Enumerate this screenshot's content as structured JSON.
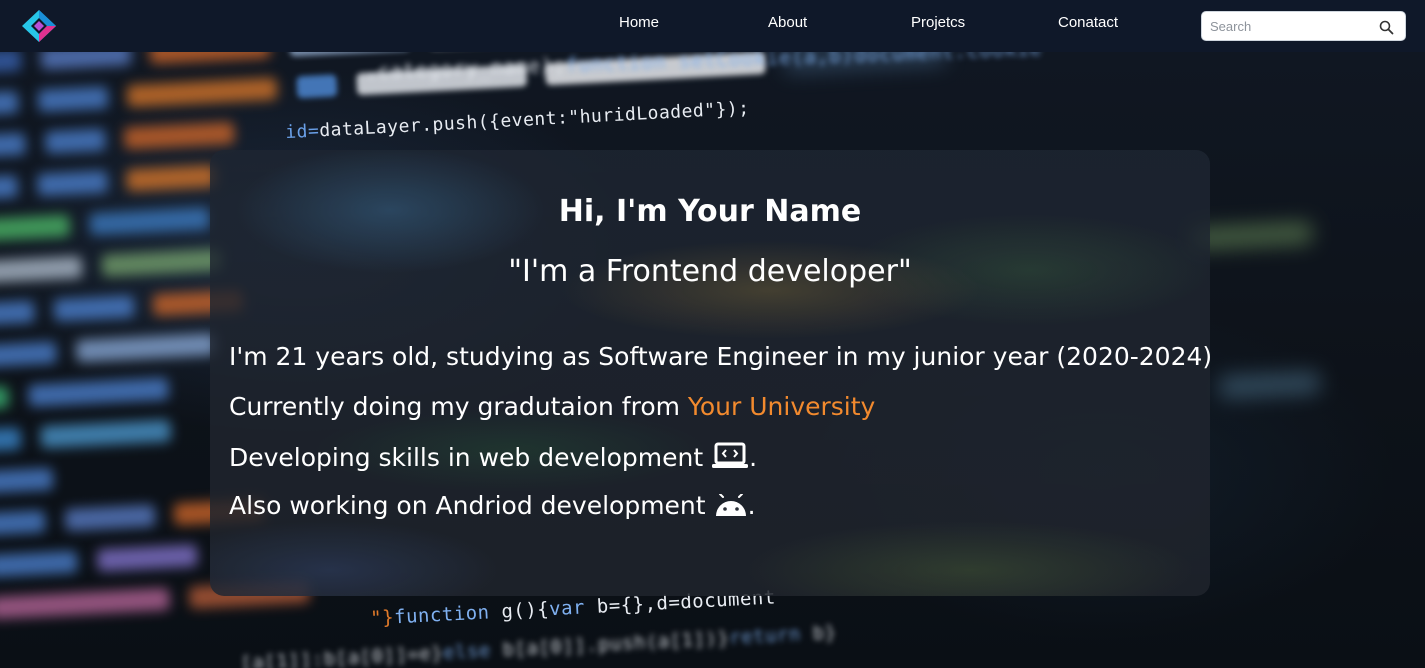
{
  "nav": {
    "logo_icon": "diamond-logo-icon",
    "links": [
      {
        "label": "Home"
      },
      {
        "label": "About"
      },
      {
        "label": "Projetcs"
      },
      {
        "label": "Conatact"
      }
    ],
    "search": {
      "placeholder": "Search",
      "value": "",
      "icon": "search-icon"
    }
  },
  "hero": {
    "title": "Hi, I'm Your Name",
    "subtitle": "\"I'm a Frontend developer\"",
    "line1": "I'm 21 years old, studying as Software Engineer in my junior year (2020-2024).",
    "line2_prefix": "Currently doing my gradutaion from ",
    "line2_highlight": "Your University",
    "line3": "Developing skills in web development",
    "line3_icon": "laptop-code-icon",
    "line3_suffix": ".",
    "line4": "Also working on Andriod development",
    "line4_icon": "android-icon",
    "line4_suffix": "."
  },
  "colors": {
    "navbar": "#0f1829",
    "highlight": "#f28a2e",
    "text": "#ffffff"
  }
}
